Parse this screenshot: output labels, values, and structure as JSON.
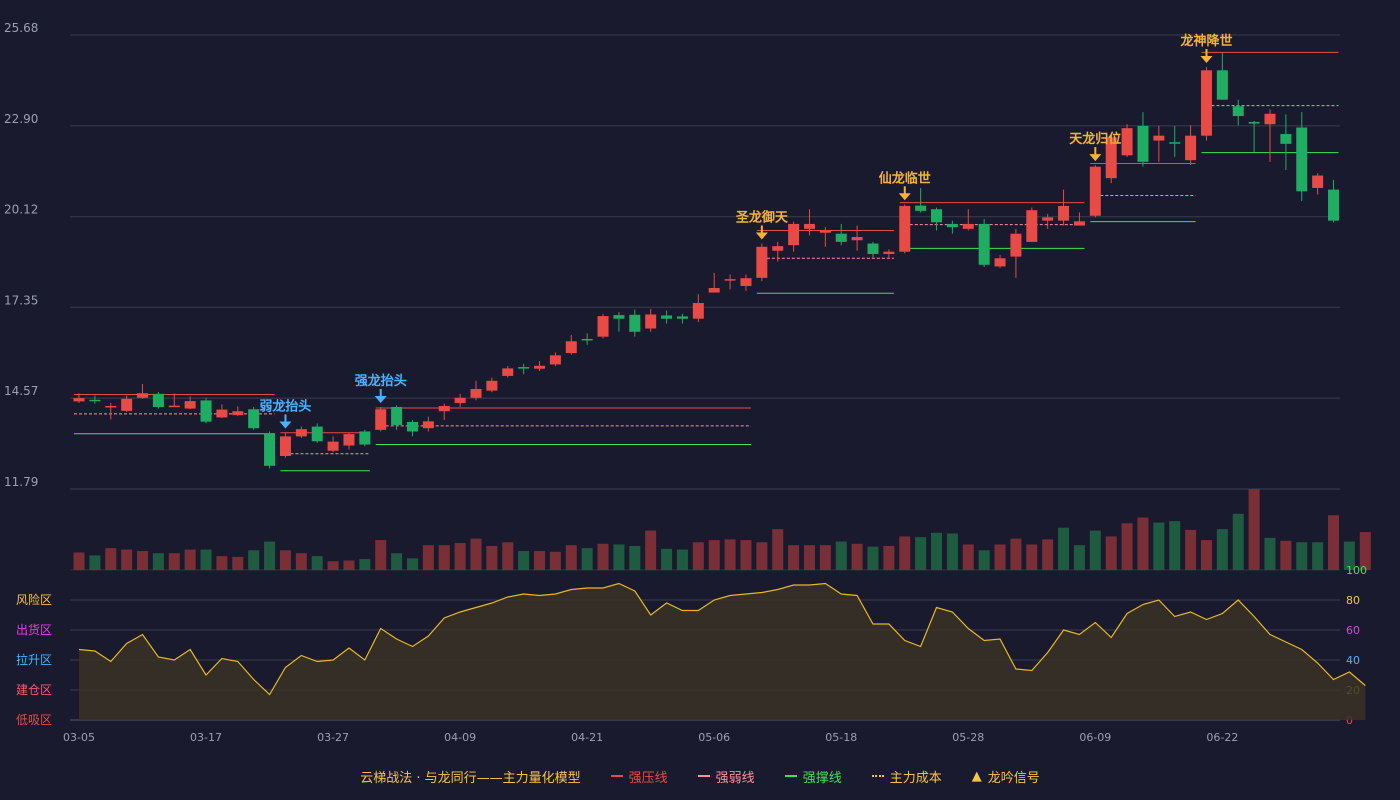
{
  "colors": {
    "background": "#1a1a2e",
    "up": "#e84a45",
    "down": "#1fad63",
    "pressure": "#e84a45",
    "weak": "#ff8fa0",
    "support": "#3ee15a",
    "cost": "#f5c542",
    "signal_red": "#f5b335",
    "signal_blue": "#45b4ff",
    "grid": "#3a3c4e",
    "axis_text": "#9aa0b0"
  },
  "legend": {
    "title": "云梯战法 · 与龙同行——主力量化模型",
    "pressure": "强压线",
    "weak": "强弱线",
    "support": "强撑线",
    "cost": "主力成本",
    "signal": "龙吟信号"
  },
  "chart_data": [
    {
      "type": "candlestick",
      "y_ticks": [
        "25.68",
        "22.90",
        "20.12",
        "17.35",
        "14.57",
        "11.79"
      ],
      "ylim": [
        11.79,
        25.68
      ],
      "x_ticks": [
        {
          "index": 0,
          "label": "03-05"
        },
        {
          "index": 8,
          "label": "03-17"
        },
        {
          "index": 16,
          "label": "03-27"
        },
        {
          "index": 24,
          "label": "04-09"
        },
        {
          "index": 32,
          "label": "04-21"
        },
        {
          "index": 40,
          "label": "05-06"
        },
        {
          "index": 48,
          "label": "05-18"
        },
        {
          "index": 56,
          "label": "05-28"
        },
        {
          "index": 64,
          "label": "06-09"
        },
        {
          "index": 72,
          "label": "06-22"
        }
      ],
      "candles": [
        [
          14.47,
          14.57,
          14.72,
          14.42
        ],
        [
          14.52,
          14.49,
          14.65,
          14.4
        ],
        [
          14.3,
          14.33,
          14.42,
          13.92
        ],
        [
          14.18,
          14.55,
          14.65,
          14.15
        ],
        [
          14.58,
          14.72,
          15.0,
          14.55
        ],
        [
          14.7,
          14.3,
          14.76,
          14.25
        ],
        [
          14.33,
          14.34,
          14.71,
          14.31
        ],
        [
          14.25,
          14.48,
          14.62,
          14.23
        ],
        [
          14.5,
          13.85,
          14.58,
          13.8
        ],
        [
          13.98,
          14.22,
          14.38,
          13.96
        ],
        [
          14.05,
          14.17,
          14.32,
          14.02
        ],
        [
          14.23,
          13.65,
          14.3,
          13.6
        ],
        [
          13.5,
          12.5,
          13.55,
          12.42
        ],
        [
          12.8,
          13.4,
          13.52,
          12.75
        ],
        [
          13.4,
          13.62,
          13.7,
          13.35
        ],
        [
          13.7,
          13.25,
          13.8,
          13.2
        ],
        [
          12.96,
          13.24,
          13.4,
          12.92
        ],
        [
          13.12,
          13.47,
          13.5,
          13.0
        ],
        [
          13.55,
          13.15,
          13.6,
          13.1
        ],
        [
          13.6,
          14.23,
          14.3,
          13.55
        ],
        [
          14.3,
          13.75,
          14.35,
          13.6
        ],
        [
          13.84,
          13.55,
          13.9,
          13.4
        ],
        [
          13.65,
          13.86,
          14.0,
          13.55
        ],
        [
          14.17,
          14.33,
          14.4,
          13.9
        ],
        [
          14.42,
          14.58,
          14.7,
          14.3
        ],
        [
          14.58,
          14.85,
          15.1,
          14.5
        ],
        [
          14.8,
          15.1,
          15.2,
          14.75
        ],
        [
          15.25,
          15.48,
          15.55,
          15.2
        ],
        [
          15.52,
          15.5,
          15.62,
          15.3
        ],
        [
          15.47,
          15.56,
          15.7,
          15.4
        ],
        [
          15.6,
          15.88,
          15.97,
          15.55
        ],
        [
          15.95,
          16.31,
          16.5,
          15.9
        ],
        [
          16.38,
          16.36,
          16.55,
          16.2
        ],
        [
          16.45,
          17.08,
          17.15,
          16.4
        ],
        [
          17.11,
          17.0,
          17.2,
          16.6
        ],
        [
          17.12,
          16.6,
          17.28,
          16.45
        ],
        [
          16.7,
          17.13,
          17.3,
          16.6
        ],
        [
          17.1,
          17.0,
          17.25,
          16.85
        ],
        [
          17.07,
          17.0,
          17.15,
          16.85
        ],
        [
          17.0,
          17.48,
          17.75,
          16.9
        ],
        [
          17.8,
          17.94,
          18.4,
          17.8
        ],
        [
          18.2,
          18.21,
          18.35,
          17.9
        ],
        [
          18.0,
          18.24,
          18.35,
          17.85
        ],
        [
          18.25,
          19.2,
          19.3,
          18.15
        ],
        [
          19.08,
          19.22,
          19.35,
          18.75
        ],
        [
          19.25,
          19.9,
          19.97,
          19.05
        ],
        [
          19.75,
          19.9,
          20.35,
          19.55
        ],
        [
          19.63,
          19.7,
          19.8,
          19.2
        ],
        [
          19.6,
          19.35,
          19.9,
          19.25
        ],
        [
          19.4,
          19.5,
          19.85,
          19.08
        ],
        [
          19.3,
          18.98,
          19.35,
          18.88
        ],
        [
          18.98,
          19.05,
          19.12,
          18.85
        ],
        [
          19.05,
          20.45,
          20.5,
          19.0
        ],
        [
          20.46,
          20.3,
          21.0,
          20.25
        ],
        [
          20.35,
          19.95,
          20.4,
          19.7
        ],
        [
          19.9,
          19.8,
          20.0,
          19.6
        ],
        [
          19.75,
          19.9,
          20.35,
          19.7
        ],
        [
          19.9,
          18.65,
          20.05,
          18.58
        ],
        [
          18.6,
          18.85,
          18.95,
          18.55
        ],
        [
          18.9,
          19.6,
          19.75,
          18.25
        ],
        [
          19.35,
          20.32,
          20.4,
          19.35
        ],
        [
          20.0,
          20.1,
          20.2,
          19.75
        ],
        [
          20.0,
          20.45,
          20.95,
          19.85
        ],
        [
          19.85,
          19.98,
          20.25,
          19.9
        ],
        [
          20.15,
          21.65,
          21.7,
          20.1
        ],
        [
          21.3,
          22.55,
          22.63,
          21.15
        ],
        [
          22.0,
          22.83,
          22.95,
          21.95
        ],
        [
          22.9,
          21.8,
          23.32,
          21.65
        ],
        [
          22.45,
          22.6,
          22.9,
          21.8
        ],
        [
          22.4,
          22.38,
          22.9,
          21.95
        ],
        [
          21.85,
          22.6,
          22.92,
          21.7
        ],
        [
          22.6,
          24.6,
          24.7,
          22.45
        ],
        [
          24.6,
          23.7,
          25.15,
          23.7
        ],
        [
          23.5,
          23.2,
          23.7,
          22.92
        ],
        [
          23.02,
          22.97,
          23.05,
          22.1
        ],
        [
          22.95,
          23.27,
          23.4,
          21.8
        ],
        [
          22.65,
          22.35,
          23.25,
          21.55
        ],
        [
          22.85,
          20.9,
          23.32,
          20.6
        ],
        [
          21.0,
          21.38,
          21.45,
          20.8
        ],
        [
          20.95,
          20.0,
          21.25,
          19.95
        ]
      ],
      "lines": [
        {
          "kind": "pressure",
          "from": 0,
          "to": 12,
          "value": 14.68
        },
        {
          "kind": "weak",
          "from": 0,
          "to": 12,
          "value": 14.09
        },
        {
          "kind": "support",
          "from": 0,
          "to": 12,
          "value": 13.48
        },
        {
          "kind": "pressure",
          "from": 13,
          "to": 18,
          "value": 13.51
        },
        {
          "kind": "weak",
          "from": 13,
          "to": 18,
          "value": 12.87
        },
        {
          "kind": "support",
          "from": 13,
          "to": 18,
          "value": 12.35
        },
        {
          "kind": "pressure",
          "from": 19,
          "to": 42,
          "value": 14.27
        },
        {
          "kind": "weak",
          "from": 19,
          "to": 42,
          "value": 13.72
        },
        {
          "kind": "support",
          "from": 19,
          "to": 42,
          "value": 13.15
        },
        {
          "kind": "pressure",
          "from": 43,
          "to": 51,
          "value": 19.7
        },
        {
          "kind": "weak",
          "from": 43,
          "to": 51,
          "value": 18.85
        },
        {
          "kind": "support",
          "from": 43,
          "to": 51,
          "value": 17.78
        },
        {
          "kind": "pressure",
          "from": 52,
          "to": 63,
          "value": 20.55
        },
        {
          "kind": "weak",
          "from": 52,
          "to": 63,
          "value": 19.88
        },
        {
          "kind": "support",
          "from": 52,
          "to": 63,
          "value": 19.15
        },
        {
          "kind": "pressure",
          "from": 64,
          "to": 70,
          "value": 21.75
        },
        {
          "kind": "weak",
          "from": 64,
          "to": 70,
          "value": 20.77
        },
        {
          "kind": "support",
          "from": 64,
          "to": 70,
          "value": 19.97
        },
        {
          "kind": "pressure",
          "from": 71,
          "to": 79,
          "value": 25.15
        },
        {
          "kind": "weak",
          "from": 71,
          "to": 79,
          "value": 23.52
        },
        {
          "kind": "support",
          "from": 71,
          "to": 79,
          "value": 22.08
        }
      ],
      "signals": [
        {
          "index": 13,
          "label": "弱龙抬头",
          "color": "blue"
        },
        {
          "index": 19,
          "label": "强龙抬头",
          "color": "blue"
        },
        {
          "index": 43,
          "label": "圣龙御天",
          "color": "red"
        },
        {
          "index": 52,
          "label": "仙龙临世",
          "color": "red"
        },
        {
          "index": 64,
          "label": "天龙归位",
          "color": "red"
        },
        {
          "index": 71,
          "label": "龙神降世",
          "color": "red"
        }
      ]
    },
    {
      "type": "bar",
      "name": "volume",
      "values": [
        24,
        20,
        30,
        28,
        26,
        23,
        23,
        28,
        28,
        19,
        18,
        27,
        39,
        27,
        23,
        19,
        12,
        13,
        15,
        41,
        23,
        16,
        34,
        34,
        37,
        43,
        33,
        38,
        26,
        26,
        25,
        34,
        30,
        36,
        35,
        33,
        54,
        29,
        28,
        38,
        41,
        42,
        41,
        38,
        56,
        34,
        34,
        34,
        39,
        36,
        32,
        33,
        46,
        45,
        51,
        50,
        35,
        27,
        35,
        43,
        35,
        42,
        58,
        34,
        54,
        46,
        64,
        72,
        65,
        67,
        55,
        41,
        56,
        77,
        111,
        44,
        40,
        38,
        38,
        75,
        39,
        52
      ],
      "up": [
        true,
        false,
        true,
        true,
        true,
        false,
        true,
        true,
        false,
        true,
        true,
        false,
        false,
        true,
        true,
        false,
        true,
        true,
        false,
        true,
        false,
        false,
        true,
        true,
        true,
        true,
        true,
        true,
        false,
        true,
        true,
        true,
        false,
        true,
        false,
        false,
        true,
        false,
        false,
        true,
        true,
        true,
        true,
        true,
        true,
        true,
        true,
        true,
        false,
        true,
        false,
        true,
        true,
        false,
        false,
        false,
        true,
        false,
        true,
        true,
        true,
        true,
        false,
        false,
        false,
        true,
        true,
        true,
        false,
        false,
        true,
        true,
        false,
        false,
        true,
        false,
        true,
        false,
        false,
        true,
        false,
        true
      ]
    },
    {
      "type": "area",
      "name": "oscillator",
      "y_right_ticks": [
        "100",
        "80",
        "60",
        "40",
        "20",
        "0"
      ],
      "y_right_colors": [
        "#3ee15a",
        "#f5c542",
        "#e040e0",
        "#45b4ff",
        "#f5c542",
        "#e84a45"
      ],
      "zones": [
        {
          "label": "风险区",
          "value": 80,
          "color": "#f5c542"
        },
        {
          "label": "出货区",
          "value": 60,
          "color": "#e040e0"
        },
        {
          "label": "拉升区",
          "value": 40,
          "color": "#45b4ff"
        },
        {
          "label": "建仓区",
          "value": 20,
          "color": "#ff5577"
        },
        {
          "label": "低吸区",
          "value": 0,
          "color": "#e84a45"
        }
      ],
      "ylim": [
        0,
        100
      ],
      "values": [
        47,
        46,
        39,
        51,
        57,
        42,
        40,
        47,
        30,
        41,
        39,
        27,
        17,
        35,
        43,
        39,
        40,
        48,
        40,
        61,
        54,
        49,
        56,
        68,
        72,
        75,
        78,
        82,
        84,
        83,
        84,
        87,
        88,
        88,
        91,
        86,
        70,
        78,
        73,
        73,
        80,
        83,
        84,
        85,
        87,
        90,
        90,
        91,
        84,
        83,
        64,
        64,
        53,
        49,
        75,
        72,
        61,
        53,
        54,
        34,
        33,
        45,
        60,
        57,
        65,
        55,
        71,
        77,
        80,
        69,
        72,
        67,
        71,
        80,
        69,
        57,
        52,
        47,
        38,
        27,
        32,
        23
      ]
    }
  ]
}
